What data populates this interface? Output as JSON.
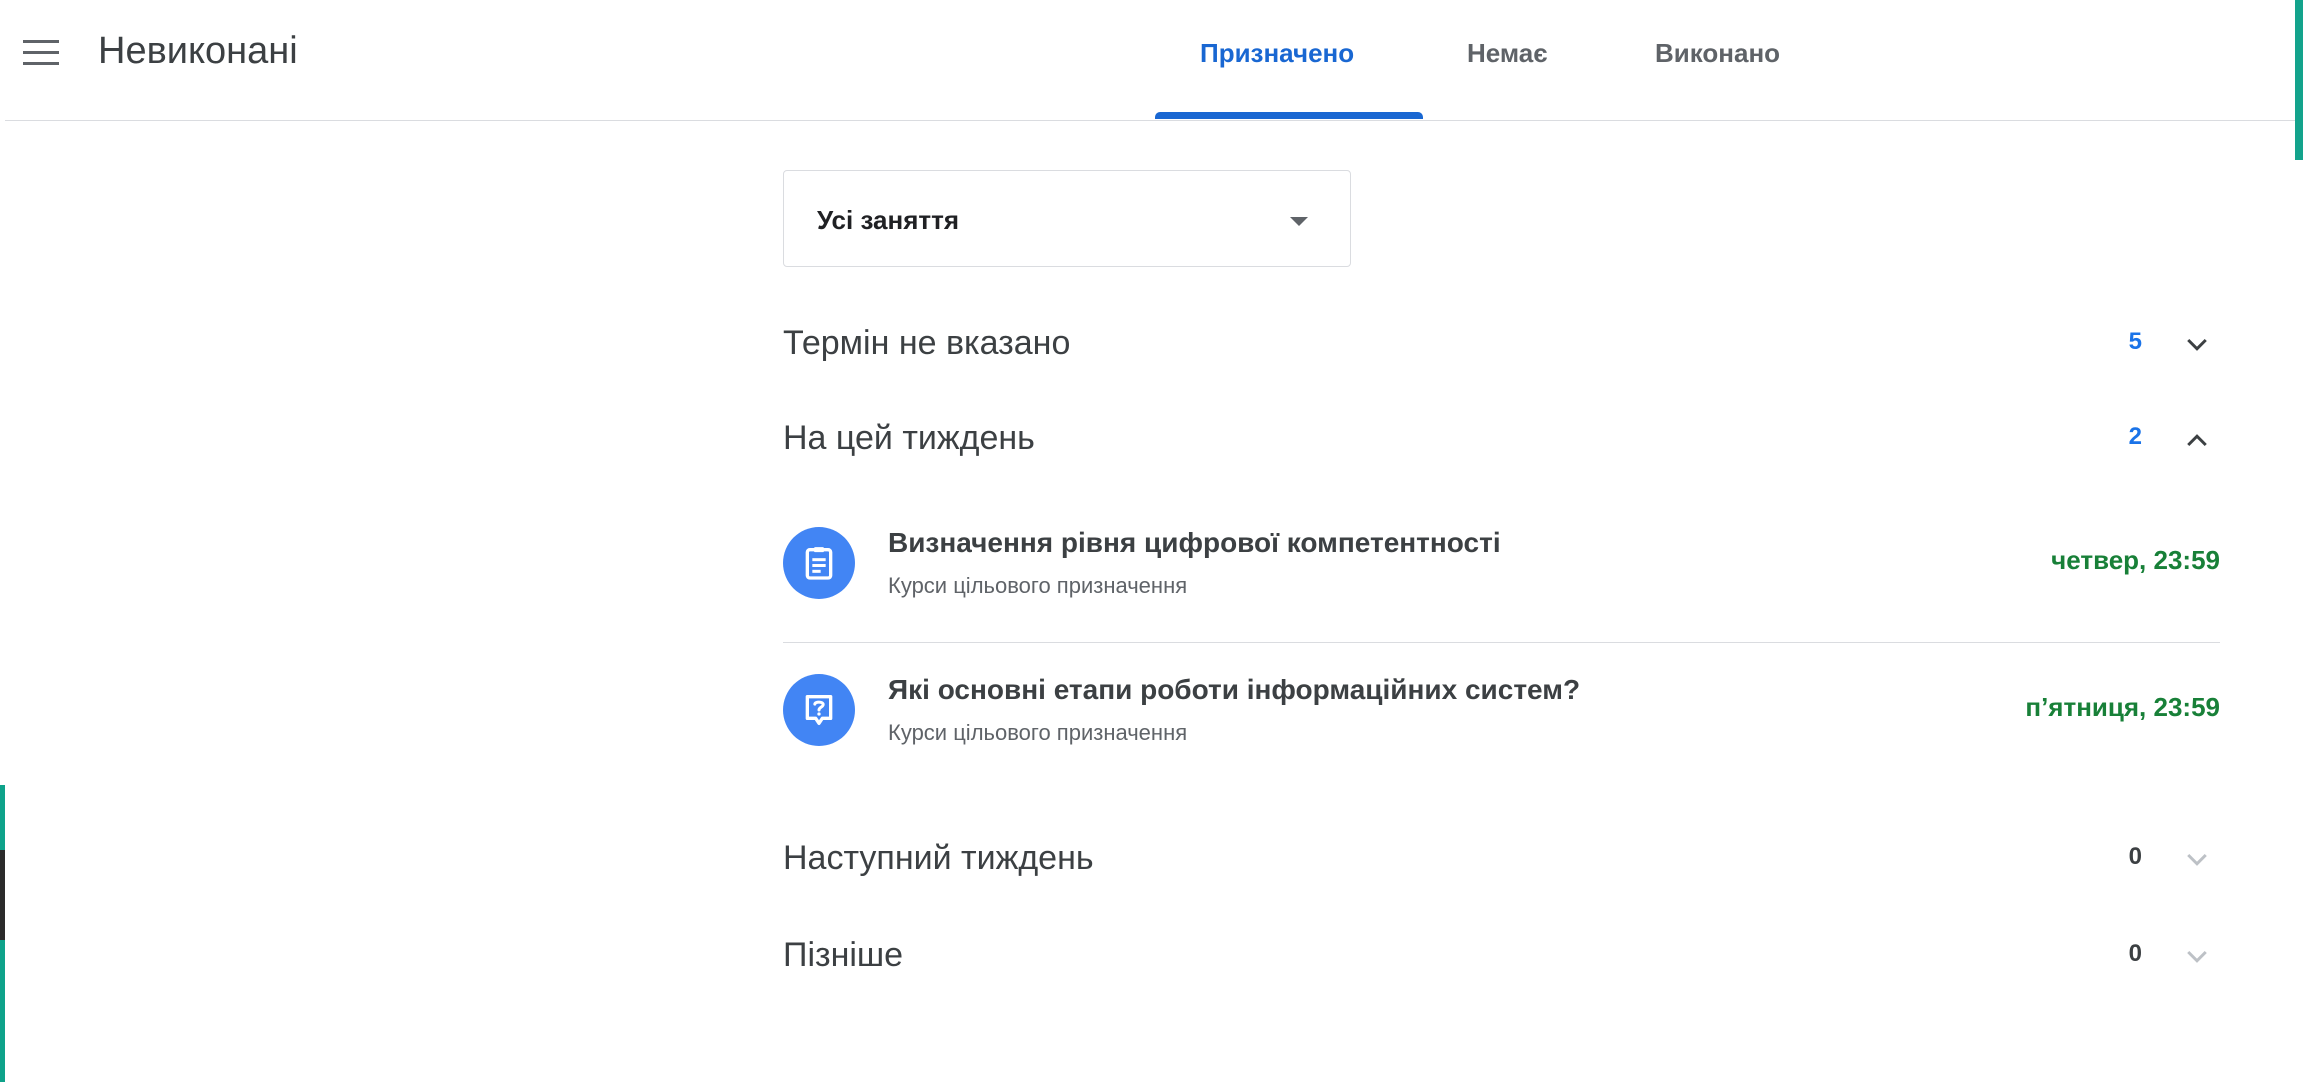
{
  "header": {
    "title": "Невиконані",
    "tabs": [
      {
        "label": "Призначено",
        "active": true
      },
      {
        "label": "Немає",
        "active": false
      },
      {
        "label": "Виконано",
        "active": false
      }
    ]
  },
  "filter": {
    "selected": "Усі заняття"
  },
  "sections": [
    {
      "title": "Термін не вказано",
      "count": "5",
      "expanded": false
    },
    {
      "title": "На цей тиждень",
      "count": "2",
      "expanded": true
    },
    {
      "title": "Наступний тиждень",
      "count": "0",
      "expanded": false
    },
    {
      "title": "Пізніше",
      "count": "0",
      "expanded": false
    }
  ],
  "items": [
    {
      "title": "Визначення рівня цифрової компетентності",
      "course": "Курси цільового призначення",
      "due": "четвер, 23:59",
      "icon": "assignment-icon"
    },
    {
      "title": "Які основні етапи роботи інформаційних систем?",
      "course": "Курси цільового призначення",
      "due": "п’ятниця, 23:59",
      "icon": "question-icon"
    }
  ],
  "colors": {
    "accent": "#1967d2",
    "count_blue": "#1a73e8",
    "due_green": "#188038",
    "icon_bg": "#4285f4"
  }
}
